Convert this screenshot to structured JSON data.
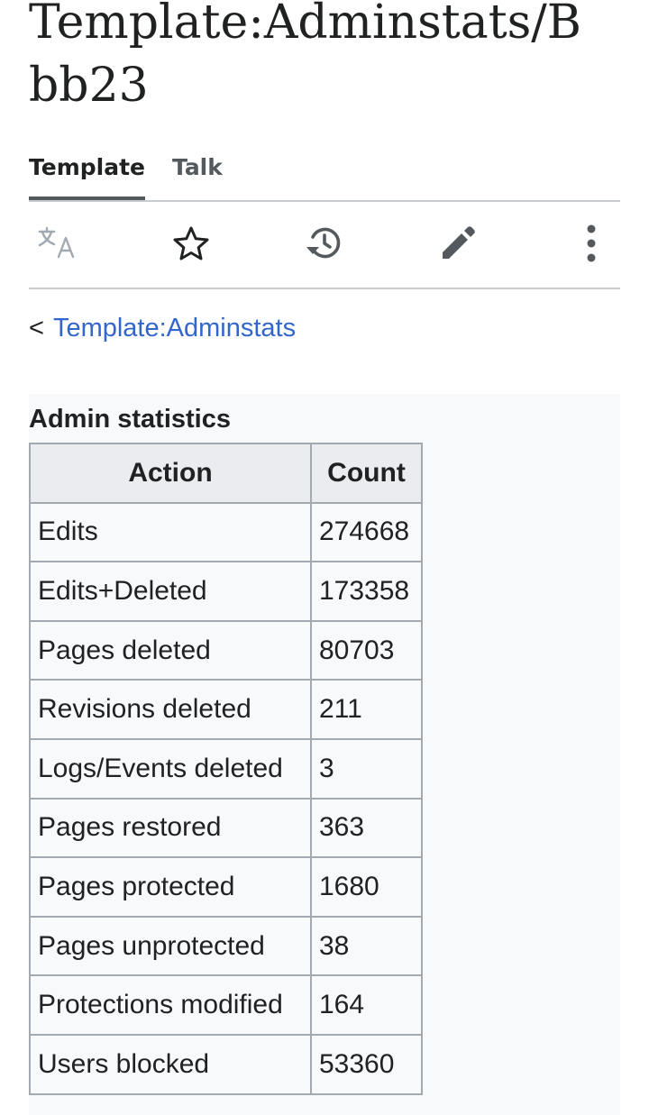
{
  "page": {
    "title": "Template:Adminstats/Bbb23"
  },
  "tabs": [
    {
      "label": "Template",
      "active": true
    },
    {
      "label": "Talk",
      "active": false
    }
  ],
  "toolbar": {
    "icons": [
      "translate-icon",
      "star-icon",
      "history-icon",
      "edit-icon",
      "more-icon"
    ],
    "icon_color": "#54595d"
  },
  "breadcrumb": {
    "prefix": "<",
    "link": "Template:Adminstats"
  },
  "stats": {
    "caption": "Admin statistics",
    "headers": [
      "Action",
      "Count"
    ],
    "rows": [
      {
        "action": "Edits",
        "count": "274668"
      },
      {
        "action": "Edits+Deleted",
        "count": "173358"
      },
      {
        "action": "Pages deleted",
        "count": "80703"
      },
      {
        "action": "Revisions deleted",
        "count": "211"
      },
      {
        "action": "Logs/Events deleted",
        "count": "3"
      },
      {
        "action": "Pages restored",
        "count": "363"
      },
      {
        "action": "Pages protected",
        "count": "1680"
      },
      {
        "action": "Pages unprotected",
        "count": "38"
      },
      {
        "action": "Protections modified",
        "count": "164"
      },
      {
        "action": "Users blocked",
        "count": "53360"
      }
    ]
  },
  "colors": {
    "link": "#3366cc",
    "text": "#202122",
    "border": "#a2a9b1",
    "header_bg": "#eaecf0",
    "box_bg": "#f8f9fa"
  }
}
